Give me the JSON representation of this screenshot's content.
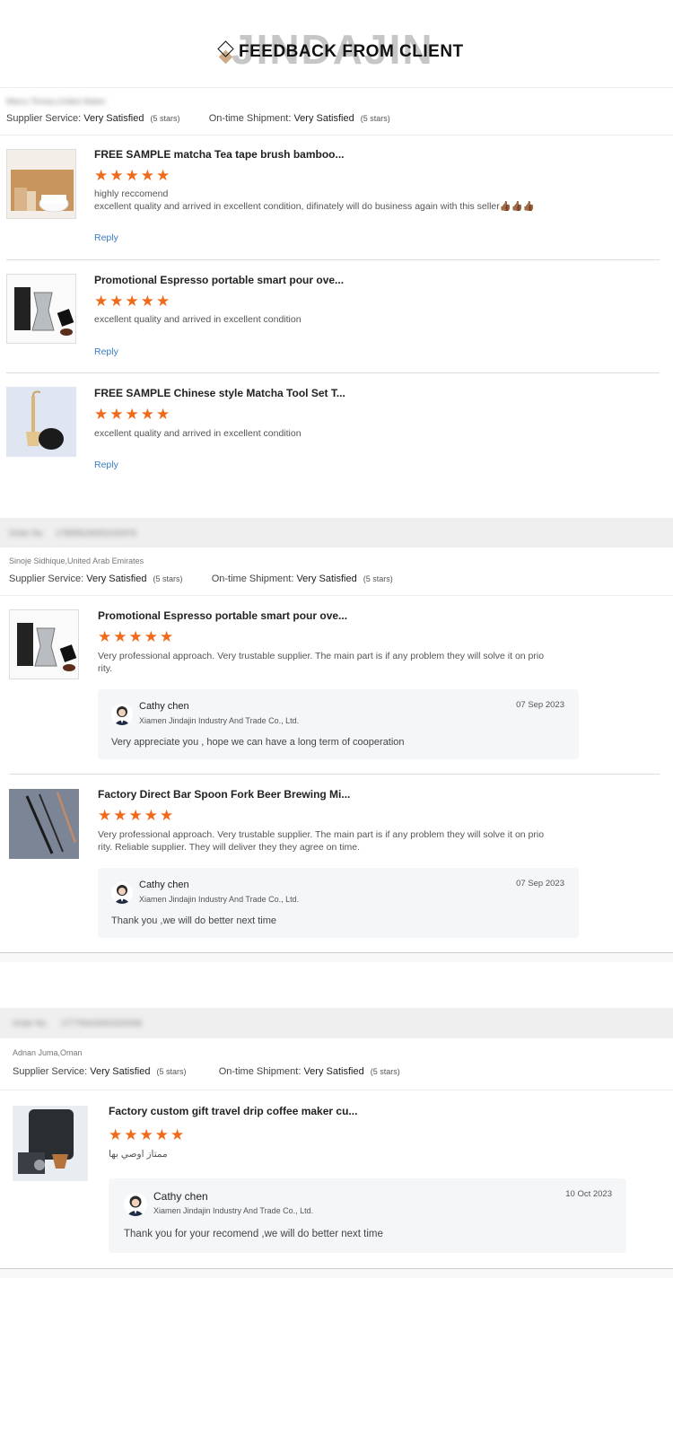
{
  "header": {
    "watermark": "JINDAJIN",
    "title": "FEEDBACK FROM CLIENT"
  },
  "colors": {
    "star": "#f06a1b",
    "link": "#3b7dc4",
    "gray_bar": "#efefef"
  },
  "labels": {
    "supplier_service": "Supplier Service:",
    "ontime_shipment": "On-time Shipment:",
    "very_satisfied": "Very Satisfied",
    "five_stars": "(5 stars)",
    "reply": "Reply",
    "order_no": "Order No."
  },
  "section1": {
    "buyer": "Marco Tomas,United States",
    "reviews": [
      {
        "title": "FREE SAMPLE matcha Tea tape brush bamboo...",
        "rating": 5,
        "text1": "highly reccomend",
        "text2": "excellent quality and arrived in excellent condition, difinately will do business again with this seller👍🏾👍🏾👍🏾"
      },
      {
        "title": "Promotional Espresso portable smart pour ove...",
        "rating": 5,
        "text1": "excellent quality and arrived in excellent condition"
      },
      {
        "title": "FREE SAMPLE Chinese style Matcha Tool Set T...",
        "rating": 5,
        "text1": "excellent quality and arrived in excellent condition"
      }
    ]
  },
  "section2": {
    "order_no": "178995230001020476",
    "buyer": "Sinoje Sidhique,United Arab Emirates",
    "reviews": [
      {
        "title": "Promotional Espresso portable smart pour ove...",
        "rating": 5,
        "text1": "Very professional approach. Very trustable supplier. The main part is if any problem they will solve it on prio",
        "text2": "rity.",
        "reply": {
          "name": "Cathy chen",
          "company": "Xiamen Jindajin Industry And Trade Co., Ltd.",
          "date": "07 Sep 2023",
          "text": "Very appreciate you ,  hope we can have a long term of cooperation"
        }
      },
      {
        "title": "Factory Direct Bar Spoon Fork Beer Brewing Mi...",
        "rating": 5,
        "text1": "Very professional approach. Very trustable supplier. The main part is if any problem they will solve it on prio",
        "text2": "rity. Reliable supplier. They will deliver they they agree on time.",
        "reply": {
          "name": "Cathy chen",
          "company": "Xiamen Jindajin Industry And Trade Co., Ltd.",
          "date": "07 Sep 2023",
          "text": "Thank you ,we will do better next time"
        }
      }
    ]
  },
  "section3": {
    "order_no": "177793102001520336",
    "buyer": "Adnan Juma,Oman",
    "reviews": [
      {
        "title": "Factory custom gift travel drip coffee maker cu...",
        "rating": 5,
        "text1": "ممتاز اوصي بها",
        "reply": {
          "name": "Cathy chen",
          "company": "Xiamen Jindajin Industry And Trade Co., Ltd.",
          "date": "10 Oct 2023",
          "text": "Thank you for your recomend ,we will do better next time"
        }
      }
    ]
  }
}
